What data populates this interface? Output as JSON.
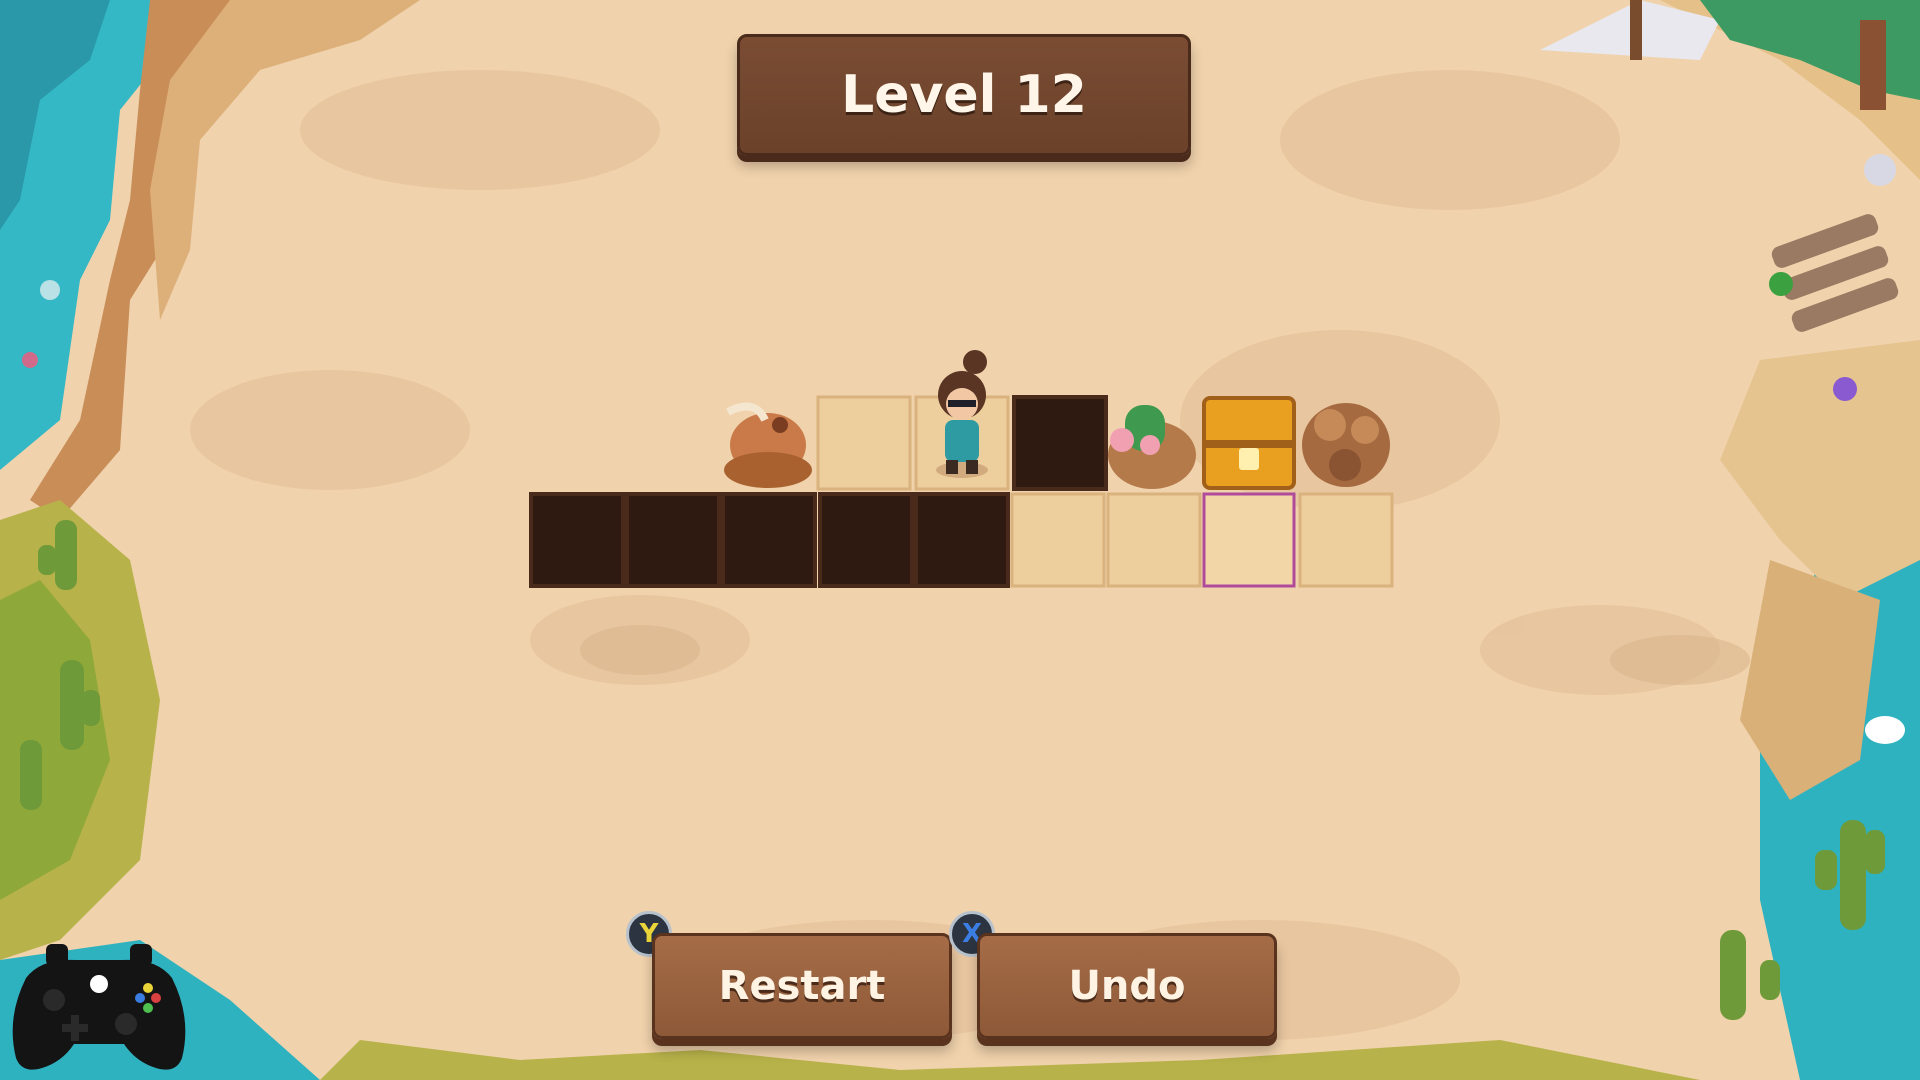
{
  "hud": {
    "level_title": "Level 12"
  },
  "buttons": {
    "restart": {
      "label": "Restart",
      "hint_key": "Y"
    },
    "undo": {
      "label": "Undo",
      "hint_key": "X"
    }
  },
  "board": {
    "row_top": [
      "critter",
      "sand",
      "player",
      "pit",
      "cactus-rocks",
      "treasure-chest",
      "rock-pile"
    ],
    "row_bottom": [
      "pit",
      "pit",
      "pit",
      "pit",
      "pit",
      "sand",
      "sand",
      "target-sand",
      "sand"
    ]
  },
  "colors": {
    "sand": "#f0d2ac",
    "panel": "#6b412a",
    "button": "#9a6240",
    "pit": "#2e1a10",
    "water": "#35b8c5",
    "grass": "#9ab23c",
    "chest": "#e9a020",
    "target_border": "#b04a9a"
  }
}
